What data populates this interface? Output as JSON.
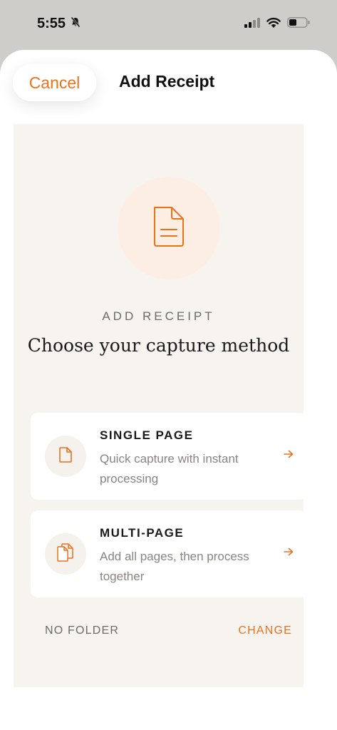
{
  "status_bar": {
    "time": "5:55",
    "icons": [
      "bell-slash-icon",
      "cellular-signal-icon",
      "wifi-icon",
      "battery-icon"
    ]
  },
  "nav": {
    "cancel_label": "Cancel",
    "title": "Add Receipt"
  },
  "hero": {
    "icon": "document-icon",
    "eyebrow": "ADD RECEIPT",
    "headline": "Choose your capture method"
  },
  "options": [
    {
      "icon": "single-page-icon",
      "title": "SINGLE PAGE",
      "description": "Quick capture with instant processing"
    },
    {
      "icon": "multi-page-icon",
      "title": "MULTI-PAGE",
      "description": "Add all pages, then process together"
    }
  ],
  "folder": {
    "label": "NO FOLDER",
    "change_label": "CHANGE"
  },
  "colors": {
    "accent": "#e8731f",
    "hero_circle": "#fdeee4",
    "content_bg": "#f7f4f0"
  }
}
